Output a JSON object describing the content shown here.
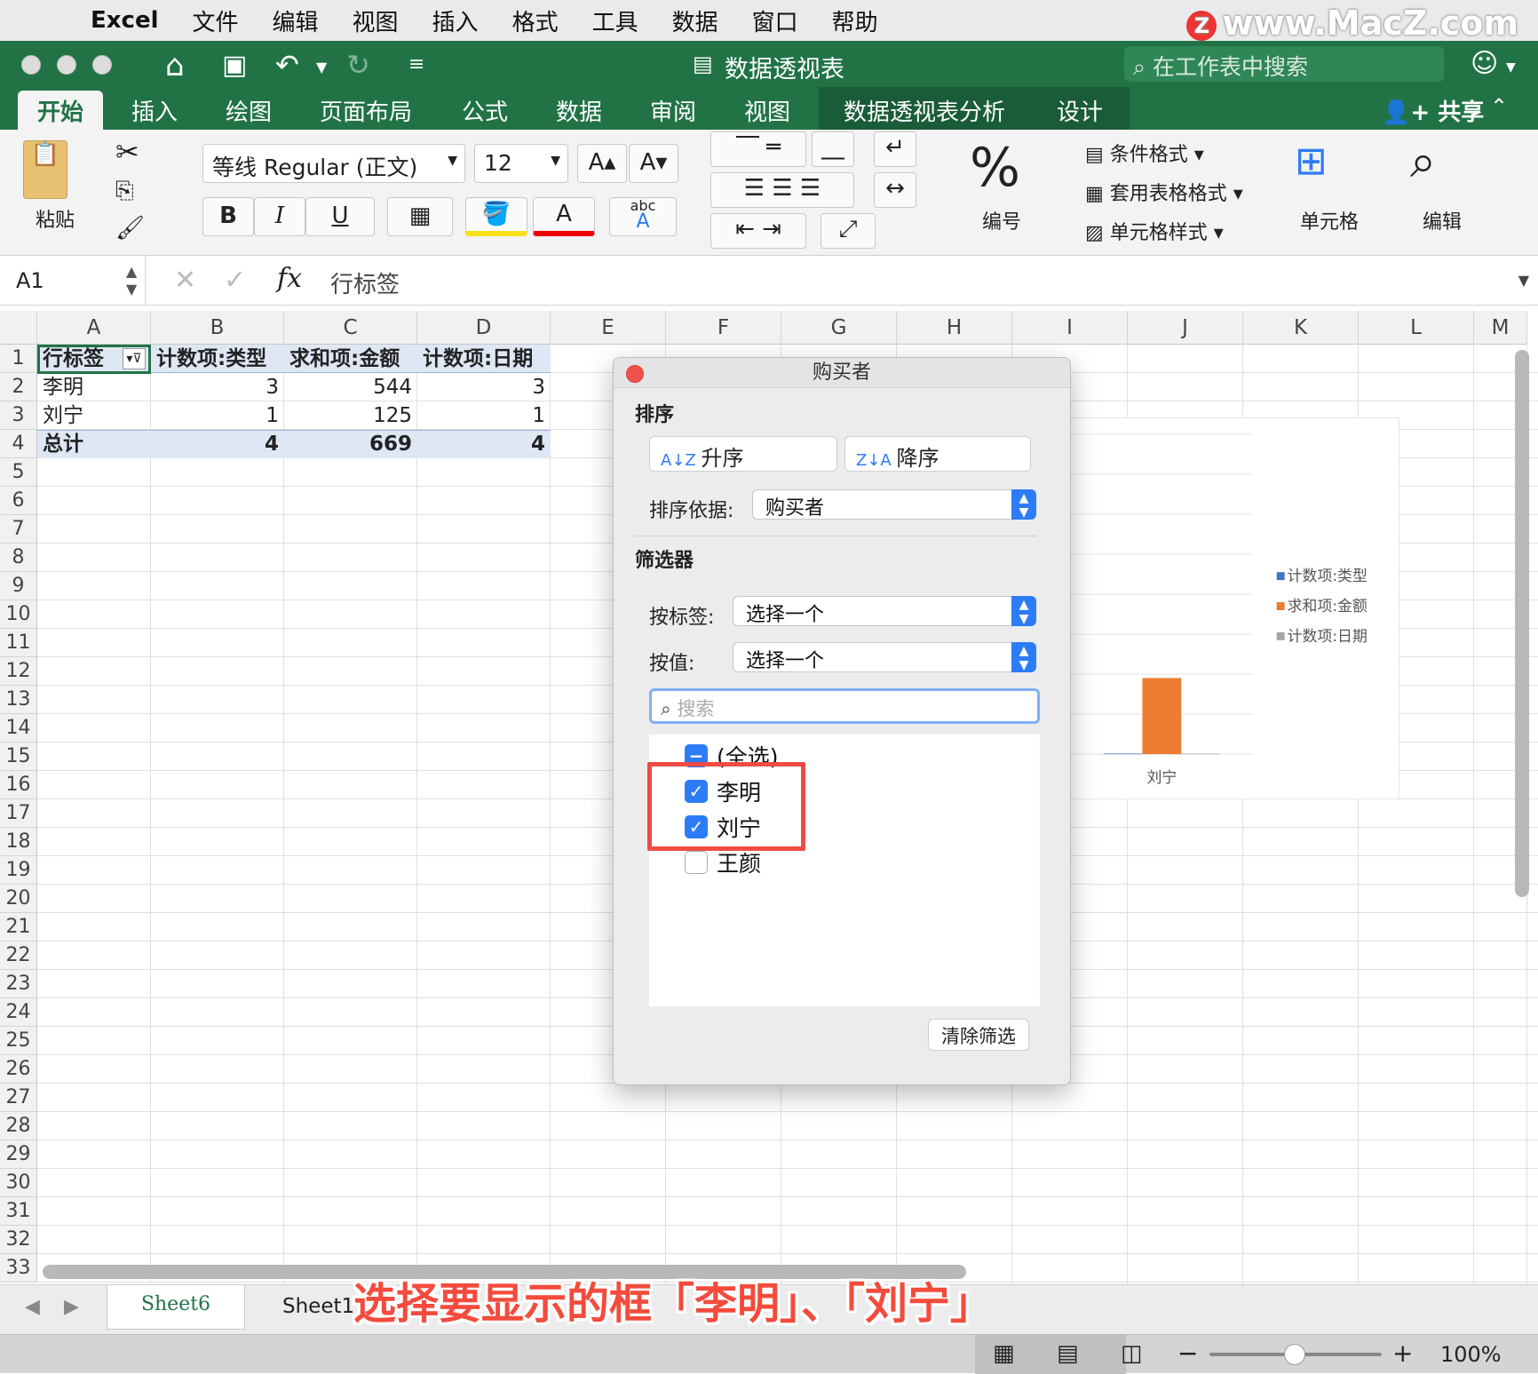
{
  "menubar": {
    "app": "Excel",
    "items": [
      "文件",
      "编辑",
      "视图",
      "插入",
      "格式",
      "工具",
      "数据",
      "窗口",
      "帮助"
    ]
  },
  "watermark": "www.MacZ.com",
  "window": {
    "title": "数据透视表",
    "search_placeholder": "在工作表中搜索"
  },
  "tabs": [
    "开始",
    "插入",
    "绘图",
    "页面布局",
    "公式",
    "数据",
    "审阅",
    "视图",
    "数据透视表分析",
    "设计"
  ],
  "share": "共享",
  "ribbon": {
    "paste": "粘贴",
    "font_name": "等线 Regular (正文)",
    "font_size": "12",
    "bold": "B",
    "italic": "I",
    "underline": "U",
    "number": "编号",
    "conditional": "条件格式",
    "table_format": "套用表格格式",
    "cell_style": "单元格样式",
    "cells": "单元格",
    "edit": "编辑"
  },
  "formula_bar": {
    "name": "A1",
    "fx": "fx",
    "content": "行标签"
  },
  "columns": [
    "A",
    "B",
    "C",
    "D",
    "E",
    "F",
    "G",
    "H",
    "I",
    "J",
    "K",
    "L",
    "M"
  ],
  "rows": [
    "1",
    "2",
    "3",
    "4",
    "5",
    "6",
    "7",
    "8",
    "9",
    "10",
    "11",
    "12",
    "13",
    "14",
    "15",
    "16",
    "17",
    "18",
    "19",
    "20",
    "21",
    "22",
    "23",
    "24",
    "25",
    "26",
    "27",
    "28",
    "29",
    "30",
    "31",
    "32",
    "33"
  ],
  "pivot": {
    "headers": [
      "行标签",
      "计数项:类型",
      "求和项:金额",
      "计数项:日期"
    ],
    "rows": [
      [
        "李明",
        "3",
        "544",
        "3"
      ],
      [
        "刘宁",
        "1",
        "125",
        "1"
      ]
    ],
    "total": [
      "总计",
      "4",
      "669",
      "4"
    ]
  },
  "chart_data": {
    "type": "bar",
    "categories": [
      "刘宁"
    ],
    "series": [
      {
        "name": "计数项:类型",
        "values": [
          1
        ]
      },
      {
        "name": "求和项:金额",
        "values": [
          125
        ]
      },
      {
        "name": "计数项:日期",
        "values": [
          1
        ]
      }
    ],
    "colors": [
      "#4472c4",
      "#ed7d31",
      "#a5a5a5"
    ],
    "legend": "right",
    "grid": true
  },
  "dialog": {
    "title": "购买者",
    "sort_section": "排序",
    "asc": "升序",
    "desc": "降序",
    "sort_by_label": "排序依据:",
    "sort_by_value": "购买者",
    "filter_section": "筛选器",
    "by_label": "按标签:",
    "by_label_value": "选择一个",
    "by_value": "按值:",
    "by_value_value": "选择一个",
    "search_placeholder": "搜索",
    "items": [
      {
        "label": "(全选)",
        "state": "mixed"
      },
      {
        "label": "李明",
        "state": "checked"
      },
      {
        "label": "刘宁",
        "state": "checked"
      },
      {
        "label": "王颜",
        "state": "unchecked"
      }
    ],
    "clear": "清除筛选"
  },
  "sheets": [
    "Sheet6",
    "Sheet1"
  ],
  "caption": "选择要显示的框「李明」、「刘宁」",
  "zoom": "100%"
}
